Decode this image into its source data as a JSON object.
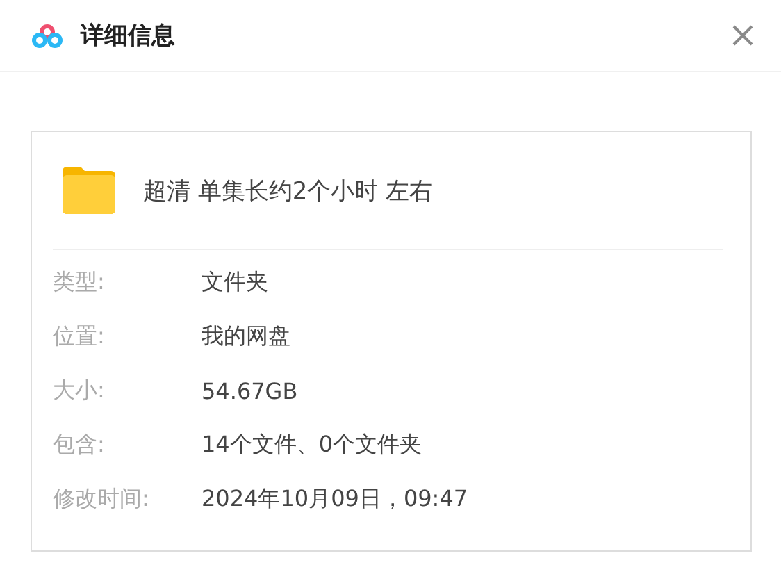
{
  "dialog": {
    "title": "详细信息"
  },
  "file": {
    "name": "超清 单集长约2个小时 左右"
  },
  "properties": [
    {
      "label": "类型:",
      "value": "文件夹"
    },
    {
      "label": "位置:",
      "value": "我的网盘"
    },
    {
      "label": "大小:",
      "value": "54.67GB"
    },
    {
      "label": "包含:",
      "value": "14个文件、0个文件夹"
    },
    {
      "label": "修改时间:",
      "value": "2024年10月09日，09:47"
    }
  ]
}
